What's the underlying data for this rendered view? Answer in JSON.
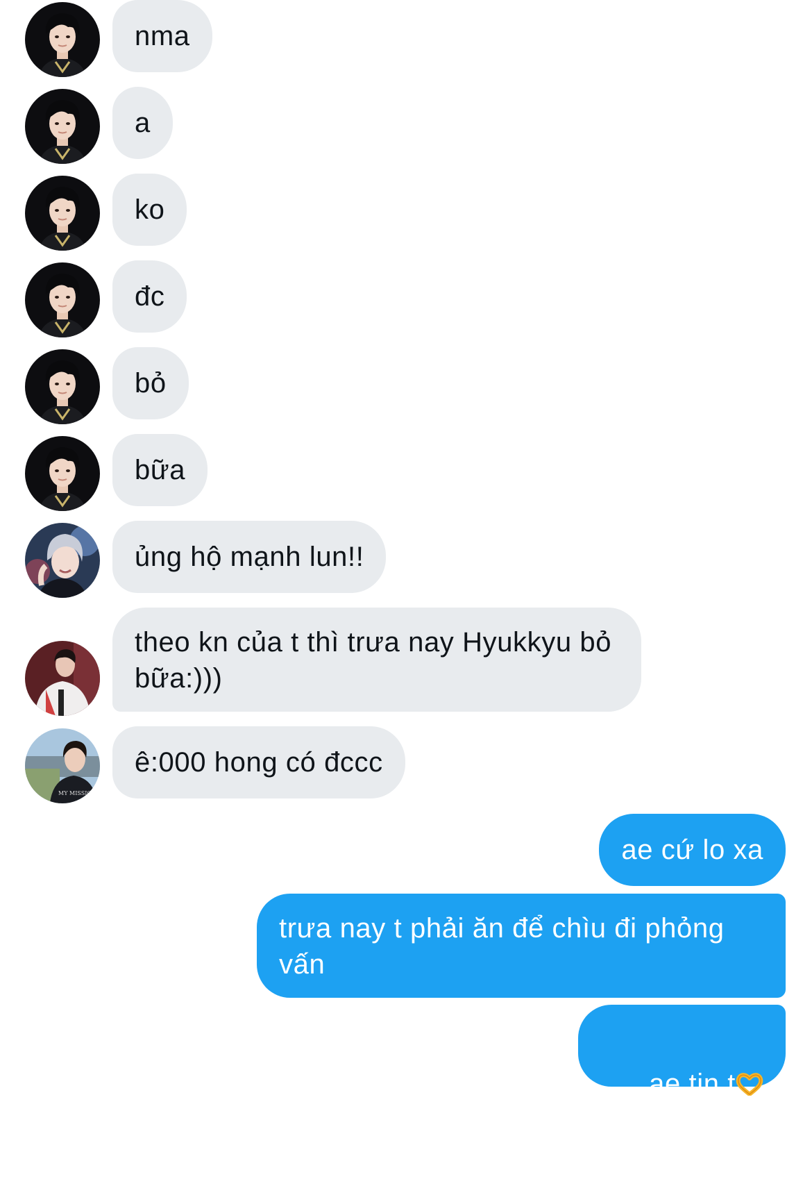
{
  "conversation": {
    "messages": [
      {
        "side": "in",
        "avatar": "avatar-boy-dark",
        "text": "nma"
      },
      {
        "side": "in",
        "avatar": "avatar-boy-dark",
        "text": "a"
      },
      {
        "side": "in",
        "avatar": "avatar-boy-dark",
        "text": "ko"
      },
      {
        "side": "in",
        "avatar": "avatar-boy-dark",
        "text": "đc"
      },
      {
        "side": "in",
        "avatar": "avatar-boy-dark",
        "text": "bỏ"
      },
      {
        "side": "in",
        "avatar": "avatar-boy-dark",
        "text": "bữa"
      },
      {
        "side": "in",
        "avatar": "avatar-silver-hair",
        "text": "ủng hộ mạnh lun!!"
      },
      {
        "side": "in",
        "avatar": "avatar-jacket",
        "text": "theo kn của t thì trưa nay Hyukkyu bỏ bữa:)))"
      },
      {
        "side": "in",
        "avatar": "avatar-outdoor",
        "text": "ê:000 hong có đccc"
      },
      {
        "side": "out",
        "text": "ae cứ lo xa"
      },
      {
        "side": "out",
        "text": "trưa nay t phải ăn để chìu đi phỏng vấn"
      },
      {
        "side": "out",
        "text": "ae tin t",
        "emoji": "heart-hands-icon"
      }
    ]
  },
  "colors": {
    "incoming_bubble": "#e8ebee",
    "outgoing_bubble": "#1da1f2",
    "incoming_text": "#0f1419",
    "outgoing_text": "#ffffff"
  }
}
